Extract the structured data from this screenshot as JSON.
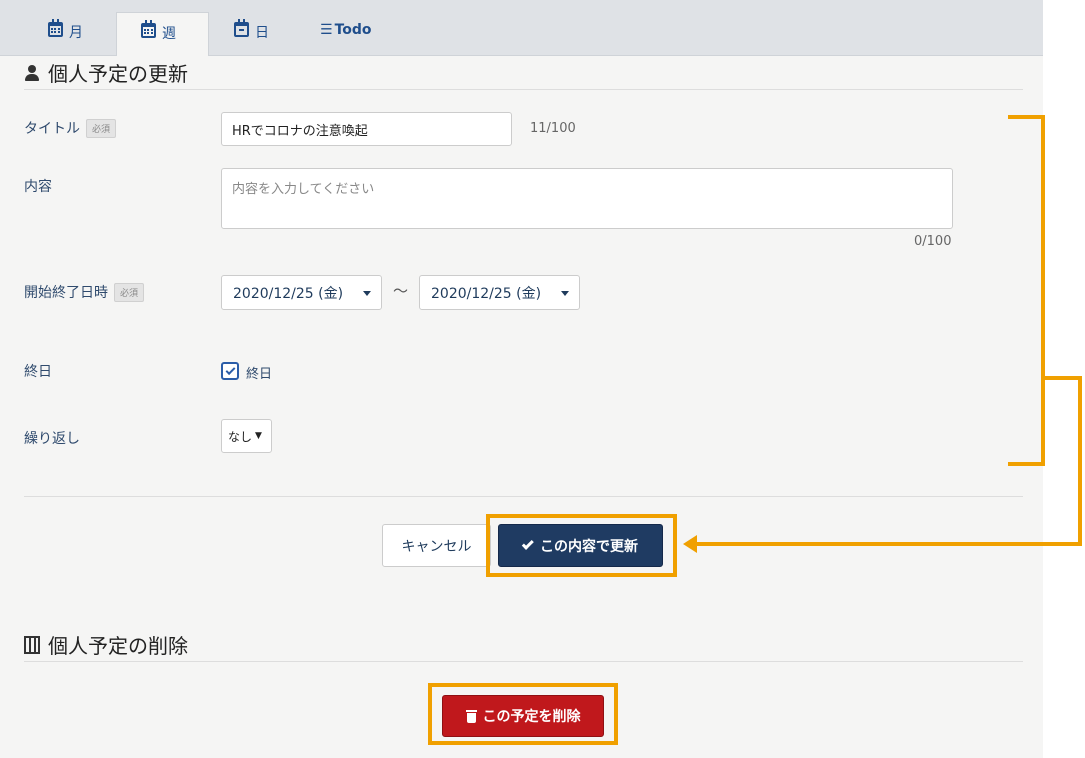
{
  "tabs": [
    {
      "label": "月",
      "icon": "calendar-icon"
    },
    {
      "label": "週",
      "icon": "calendar-week-icon"
    },
    {
      "label": "日",
      "icon": "calendar-day-icon"
    },
    {
      "label": "Todo",
      "icon": "list-icon"
    }
  ],
  "update_section": {
    "title": "個人予定の更新",
    "title_icon": "user-icon",
    "title_label": "タイトル",
    "required_label": "必須",
    "title_value": "HRでコロナの注意喚起",
    "title_counter": "11/100",
    "content_label": "内容",
    "content_placeholder": "内容を入力してください",
    "content_counter": "0/100",
    "datetime_label": "開始終了日時",
    "start_date": "2020/12/25 (金)",
    "range_separator": "〜",
    "end_date": "2020/12/25 (金)",
    "allday_label": "終日",
    "allday_checkbox_label": "終日",
    "allday_checked": true,
    "repeat_label": "繰り返し",
    "repeat_value": "なし",
    "cancel_button": "キャンセル",
    "update_button": "この内容で更新"
  },
  "delete_section": {
    "title": "個人予定の削除",
    "title_icon": "building-icon",
    "delete_button": "この予定を削除"
  },
  "colors": {
    "annotation": "#f0a000",
    "primary": "#1f3b62",
    "danger": "#c0181c"
  }
}
